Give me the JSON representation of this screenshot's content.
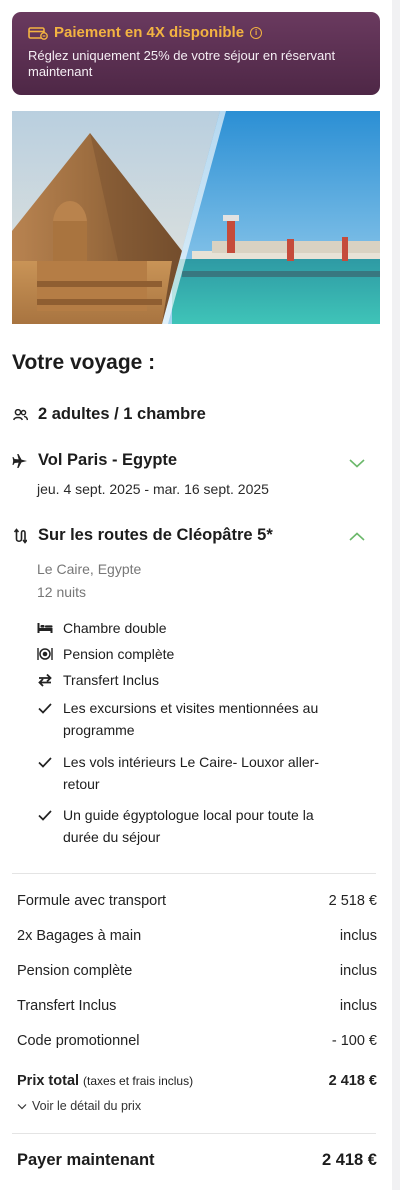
{
  "banner": {
    "title": "Paiement en 4X disponible",
    "text": "Réglez uniquement 25% de votre séjour en réservant maintenant",
    "icons": [
      "card-icon",
      "info-icon"
    ],
    "accent_color": "#f3b341",
    "background_color": "#5b2f52"
  },
  "trip": {
    "title": "Votre voyage :",
    "travellers": "2 adultes / 1 chambre",
    "flight": {
      "label": "Vol Paris - Egypte",
      "dates": "jeu. 4 sept. 2025 - mar. 16 sept. 2025"
    },
    "tour": {
      "label": "Sur les routes de Cléopâtre 5*",
      "location": "Le Caire, Egypte",
      "nights": "12 nuits",
      "features": [
        {
          "icon": "bed-icon",
          "text": "Chambre double"
        },
        {
          "icon": "meal-icon",
          "text": "Pension complète"
        },
        {
          "icon": "transfer-icon",
          "text": "Transfert Inclus"
        },
        {
          "icon": "check-icon",
          "text": "Les excursions et visites mentionnées au programme"
        },
        {
          "icon": "check-icon",
          "text": "Les vols intérieurs Le Caire- Louxor aller-retour"
        },
        {
          "icon": "check-icon",
          "text": "Un guide égyptologue local pour toute la durée du séjour"
        }
      ]
    },
    "chevron_color": "#6bb86a"
  },
  "pricing": {
    "lines": [
      {
        "label": "Formule avec transport",
        "value": "2 518 €"
      },
      {
        "label": "2x Bagages à main",
        "value": "inclus"
      },
      {
        "label": "Pension complète",
        "value": "inclus"
      },
      {
        "label": "Transfert Inclus",
        "value": "inclus"
      },
      {
        "label": "Code promotionnel",
        "value": "- 100 €"
      }
    ],
    "total_label": "Prix total",
    "total_note": "(taxes et frais inclus)",
    "total_value": "2 418 €",
    "detail_link": "Voir le détail du prix",
    "pay_now_label": "Payer maintenant",
    "pay_now_value": "2 418 €"
  }
}
